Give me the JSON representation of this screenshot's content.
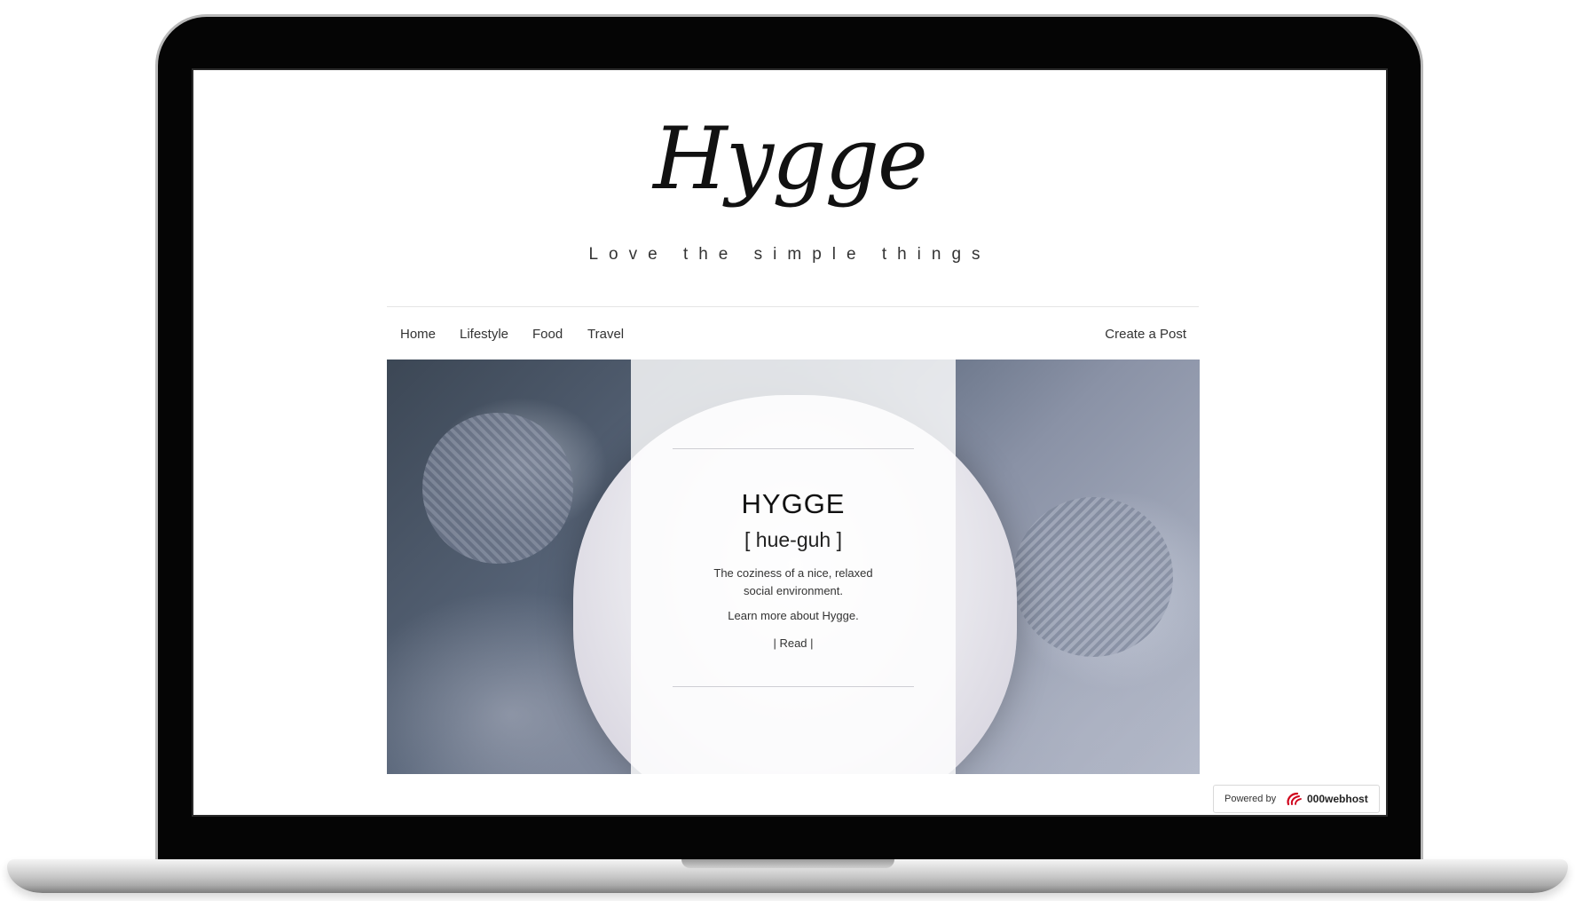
{
  "site": {
    "logo": "Hygge",
    "tagline": "Love the simple things"
  },
  "nav": {
    "items": [
      "Home",
      "Lifestyle",
      "Food",
      "Travel"
    ],
    "create_post": "Create a Post"
  },
  "hero": {
    "title": "HYGGE",
    "pronunciation": "[ hue-guh ]",
    "description": "The coziness of a nice, relaxed social environment.",
    "learn_more": "Learn more about Hygge.",
    "read_link": "| Read |"
  },
  "badge": {
    "powered_by": "Powered by",
    "brand": "000webhost"
  },
  "colors": {
    "laptop_bezel": "#050505",
    "text_dark": "#111111",
    "hero_panel": "#ffffff",
    "badge_logo": "#d0021b"
  },
  "icons": {
    "badge_logo": "000webhost-logo-icon"
  }
}
